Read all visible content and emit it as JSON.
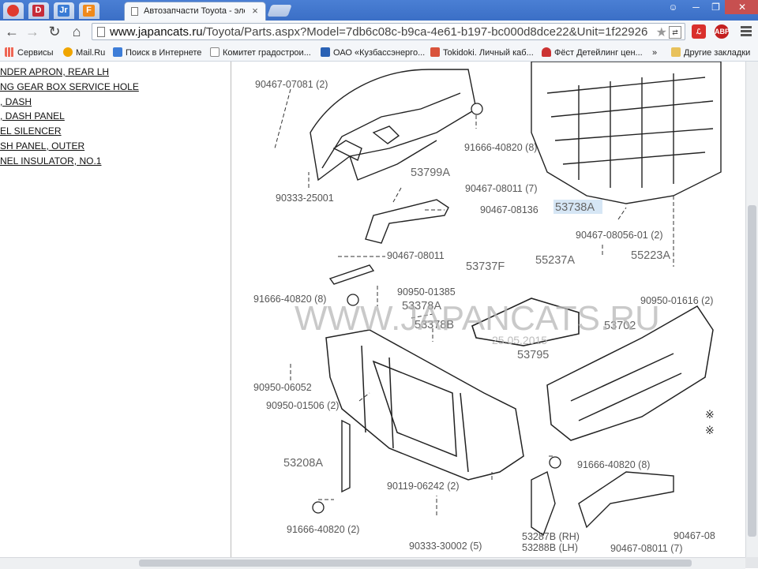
{
  "browser": {
    "pinned_tabs": [
      {
        "name": "youtube-tab",
        "glyph": "",
        "color": "#e03a2f"
      },
      {
        "name": "d-tab",
        "glyph": "D",
        "color": "#c62c3a"
      },
      {
        "name": "jr-tab",
        "glyph": "Jr",
        "color": "#3a7bd5"
      },
      {
        "name": "f-tab",
        "glyph": "F",
        "color": "#f08a1c"
      }
    ],
    "active_tab": {
      "title": "Автозапчасти Toyota - элек"
    },
    "url": "www.japancats.ru/Toyota/Parts.aspx?Model=7db6c08c-b9ca-4e61-b197-bc000d8dce22&Unit=1f22926",
    "url_host": "www.japancats.ru",
    "url_path": "/Toyota/Parts.aspx?Model=7db6c08c-b9ca-4e61-b197-bc000d8dce22&Unit=1f22926",
    "extensions": [
      {
        "name": "pdf-extension-icon",
        "label": "",
        "color": "#d9302c"
      },
      {
        "name": "adblock-icon",
        "label": "ABP",
        "color": "#c41f1f"
      }
    ]
  },
  "bookmarks": [
    {
      "label": "Сервисы",
      "color": "#e9a23b"
    },
    {
      "label": "Mail.Ru",
      "color": "#f0a500"
    },
    {
      "label": "Поиск в Интернете",
      "color": "#3d7dd8"
    },
    {
      "label": "Комитет градострои...",
      "color": "#ffffff"
    },
    {
      "label": "ОАО «Кузбассэнерго...",
      "color": "#2a62b5"
    },
    {
      "label": "Tokidoki. Личный каб...",
      "color": "#d9533b"
    },
    {
      "label": "Фёст Детейлинг цен...",
      "color": "#c33"
    },
    {
      "label": "»",
      "color": ""
    },
    {
      "label": "Другие закладки",
      "color": "#e8c15b"
    }
  ],
  "parts_list": [
    "NDER APRON, REAR LH",
    "NG GEAR BOX SERVICE HOLE",
    ", DASH",
    ", DASH PANEL",
    "EL SILENCER",
    "SH PANEL, OUTER",
    "NEL INSULATOR, NO.1"
  ],
  "diagram": {
    "watermark": "WWW.JAPANCATS.RU",
    "date": "25.05.2015",
    "labels": [
      {
        "text": "90467-07081 (2)",
        "big": false
      },
      {
        "text": "91666-40820 (8)",
        "big": false
      },
      {
        "text": "53799A",
        "big": true
      },
      {
        "text": "90333-25001",
        "big": false
      },
      {
        "text": "90467-08011 (7)",
        "big": false
      },
      {
        "text": "90467-08136",
        "big": false
      },
      {
        "text": "53738A",
        "big": true
      },
      {
        "text": "90467-08056-01 (2)",
        "big": false
      },
      {
        "text": "55237A",
        "big": true
      },
      {
        "text": "55223A",
        "big": true
      },
      {
        "text": "90467-08011",
        "big": false
      },
      {
        "text": "53737F",
        "big": true
      },
      {
        "text": "91666-40820 (8)",
        "big": false
      },
      {
        "text": "90950-01385",
        "big": false
      },
      {
        "text": "53378A",
        "big": true
      },
      {
        "text": "53378B",
        "big": true
      },
      {
        "text": "90950-01616 (2)",
        "big": false
      },
      {
        "text": "53702",
        "big": true
      },
      {
        "text": "53795",
        "big": true
      },
      {
        "text": "90950-06052",
        "big": false
      },
      {
        "text": "90950-01506 (2)",
        "big": false
      },
      {
        "text": "53208A",
        "big": true
      },
      {
        "text": "91666-40820 (8)",
        "big": false
      },
      {
        "text": "90119-06242 (2)",
        "big": false
      },
      {
        "text": "91666-40820 (2)",
        "big": false
      },
      {
        "text": "90333-30002 (5)",
        "big": false
      },
      {
        "text": "53287B (RH)",
        "big": false
      },
      {
        "text": "53288B (LH)",
        "big": false
      },
      {
        "text": "90467-08011 (7)",
        "big": false
      },
      {
        "text": "90467-08",
        "big": false
      }
    ]
  }
}
